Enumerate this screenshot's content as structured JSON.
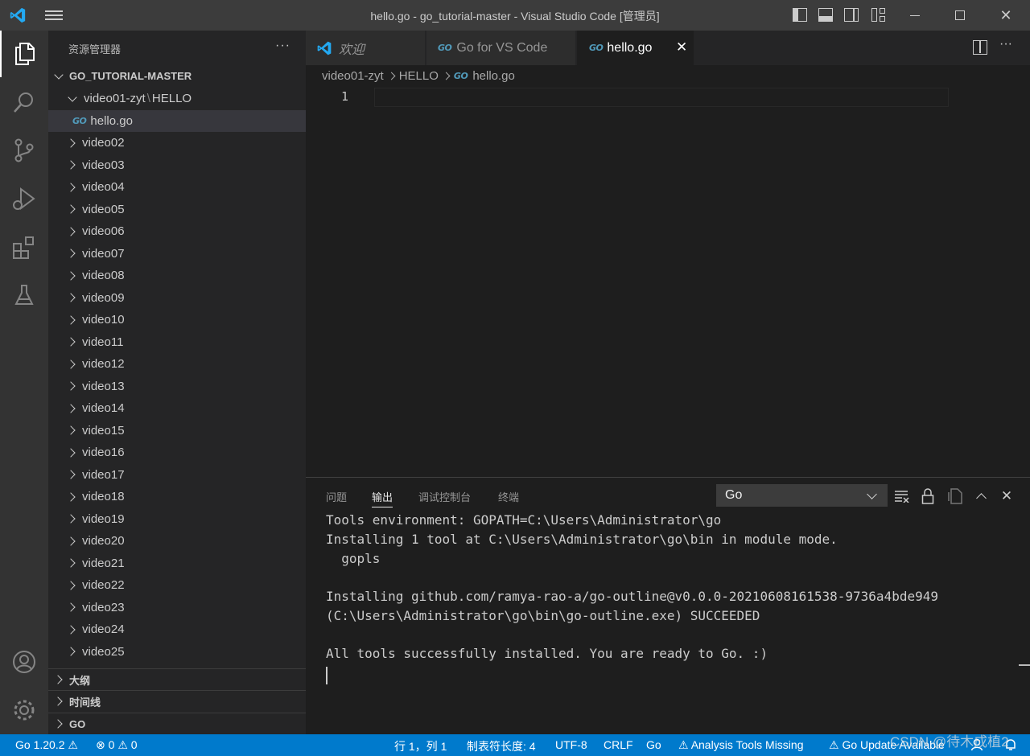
{
  "window": {
    "title": "hello.go - go_tutorial-master - Visual Studio Code [管理员]"
  },
  "sidebar": {
    "header": "资源管理器",
    "more": "···",
    "root": "GO_TUTORIAL-MASTER",
    "open_folder": "video01-zyt",
    "open_subfolder": "HELLO",
    "path_sep": "\\",
    "selected_file": "hello.go",
    "folders": [
      "video02",
      "video03",
      "video04",
      "video05",
      "video06",
      "video07",
      "video08",
      "video09",
      "video10",
      "video11",
      "video12",
      "video13",
      "video14",
      "video15",
      "video16",
      "video17",
      "video18",
      "video19",
      "video20",
      "video21",
      "video22",
      "video23",
      "video24",
      "video25"
    ],
    "sections": [
      "大纲",
      "时间线",
      "GO"
    ]
  },
  "tabs": [
    {
      "label": "欢迎",
      "icon": "vscode-icon"
    },
    {
      "label": "Go for VS Code",
      "icon": "go-file-icon"
    },
    {
      "label": "hello.go",
      "icon": "go-file-icon",
      "close": "✕"
    }
  ],
  "breadcrumb": [
    "video01-zyt",
    "HELLO",
    "hello.go"
  ],
  "editor": {
    "line_number": "1"
  },
  "panel": {
    "tabs": [
      "问题",
      "输出",
      "调试控制台",
      "终端"
    ],
    "active_tab": "输出",
    "channel": "Go",
    "output": [
      "Tools environment: GOPATH=C:\\Users\\Administrator\\go",
      "Installing 1 tool at C:\\Users\\Administrator\\go\\bin in module mode.",
      "  gopls",
      "",
      "Installing github.com/ramya-rao-a/go-outline@v0.0.0-20210608161538-9736a4bde949",
      "(C:\\Users\\Administrator\\go\\bin\\go-outline.exe) SUCCEEDED",
      "",
      "All tools successfully installed. You are ready to Go. :)"
    ]
  },
  "statusbar": {
    "go_version": "Go 1.20.2",
    "errors": "0",
    "warnings": "0",
    "position": "行 1，列 1",
    "tab_size": "制表符长度: 4",
    "encoding": "UTF-8",
    "eol": "CRLF",
    "language": "Go",
    "analysis": "Analysis Tools Missing",
    "update": "Go Update Available"
  },
  "watermark": "CSDN @待木成植2",
  "colors": {
    "accent": "#007acc",
    "go": "#519aba",
    "vscode_blue": "#23a9f2"
  }
}
